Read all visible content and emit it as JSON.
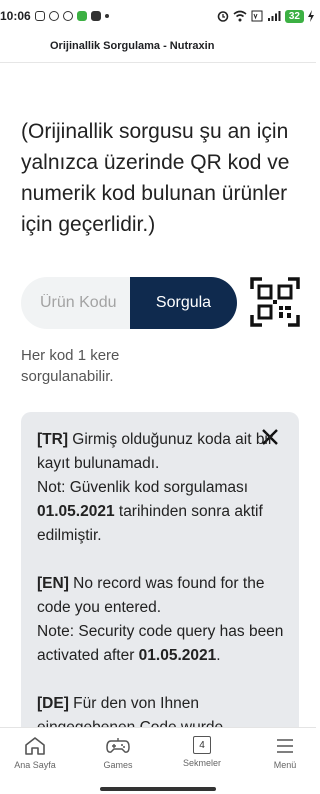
{
  "statusbar": {
    "time": "10:06",
    "battery": "32"
  },
  "titlebar": {
    "title": "Orijinallik Sorgulama - Nutraxin"
  },
  "intro": {
    "text": "(Orijinallik sorgusu şu an için yalnızca üzerinde QR kod ve numerik kod bulunan ürünler için geçerlidir.)"
  },
  "search": {
    "placeholder": "Ürün Kodu",
    "button_label": "Sorgula",
    "hint": "Her kod 1 kere sorgulanabilir."
  },
  "message": {
    "tr_tag": "[TR]",
    "tr_line1": " Girmiş olduğunuz koda ait bir kayıt bulunamadı.",
    "tr_note_pre": "Not: Güvenlik kod sorgulaması ",
    "tr_date": "01.05.2021",
    "tr_note_post": " tarihinden sonra aktif edilmiştir.",
    "en_tag": "[EN]",
    "en_line1": " No record was found for the code you entered.",
    "en_note_pre": "Note: Security code query has been activated after ",
    "en_date": "01.05.2021",
    "en_note_post": ".",
    "de_tag": "[DE]",
    "de_line1": " Für den von Ihnen eingegebenen Code wurde"
  },
  "bottomnav": {
    "items": [
      {
        "label": "Ana Sayfa",
        "icon": "home-icon"
      },
      {
        "label": "Games",
        "icon": "gamepad-icon"
      },
      {
        "label": "Sekmeler",
        "icon": "tabs-icon",
        "count": "4"
      },
      {
        "label": "Menü",
        "icon": "menu-icon"
      }
    ]
  }
}
